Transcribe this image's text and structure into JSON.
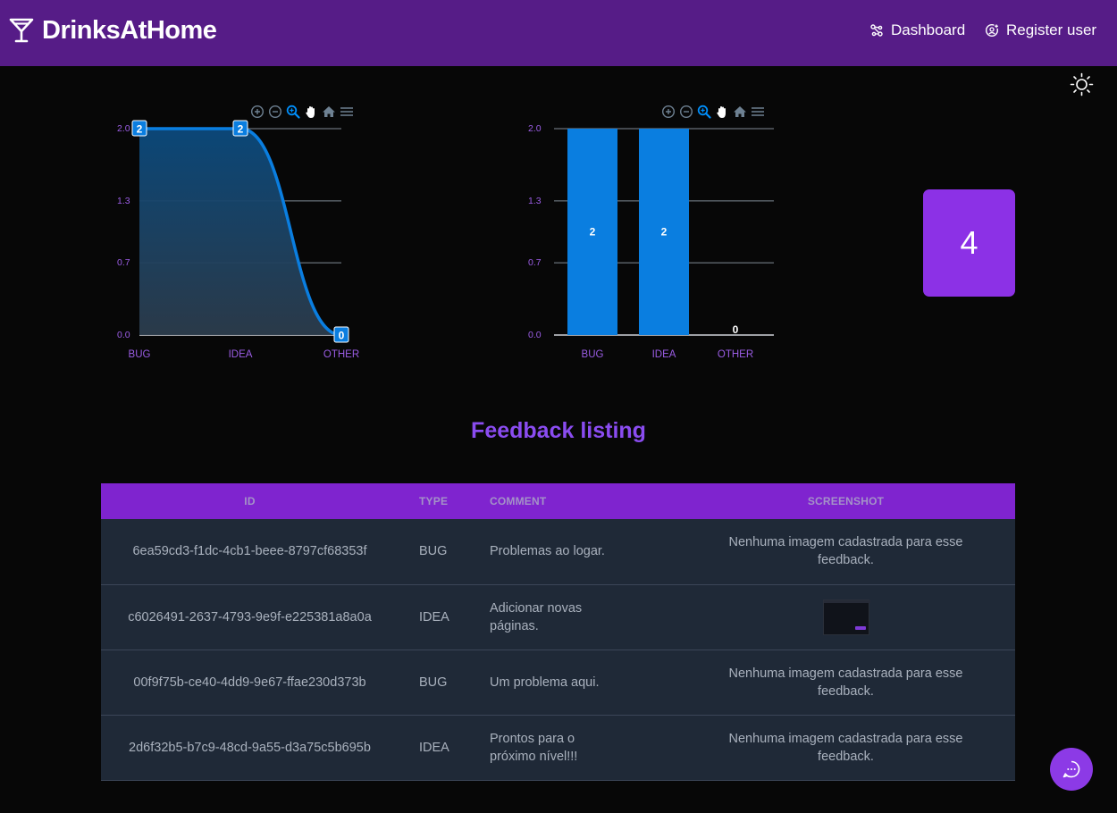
{
  "app": {
    "brand": "DrinksAtHome"
  },
  "nav": {
    "dashboard_label": "Dashboard",
    "register_label": "Register user"
  },
  "charts": {
    "yticks": [
      "0.0",
      "0.7",
      "1.3",
      "2.0"
    ],
    "tick_color": "#9b5de5",
    "series_color": "#0a7ee0"
  },
  "chart_data": [
    {
      "type": "area",
      "categories": [
        "BUG",
        "IDEA",
        "OTHER"
      ],
      "values": [
        2,
        2,
        0
      ],
      "ylim": [
        0,
        2
      ],
      "data_labels": [
        "2",
        "2",
        "0"
      ],
      "grid": true
    },
    {
      "type": "bar",
      "categories": [
        "BUG",
        "IDEA",
        "OTHER"
      ],
      "values": [
        2,
        2,
        0
      ],
      "ylim": [
        0,
        2
      ],
      "data_labels": [
        "2",
        "2",
        "0"
      ],
      "grid": true
    }
  ],
  "total_card": {
    "value": "4",
    "color": "#8c31e6"
  },
  "listing": {
    "title": "Feedback listing",
    "columns": [
      "ID",
      "TYPE",
      "COMMENT",
      "SCREENSHOT"
    ],
    "rows": [
      {
        "id": "6ea59cd3-f1dc-4cb1-beee-8797cf68353f",
        "type": "BUG",
        "comment": "Problemas ao logar.",
        "screenshot": "Nenhuma imagem cadastrada para esse feedback."
      },
      {
        "id": "c6026491-2637-4793-9e9f-e225381a8a0a",
        "type": "IDEA",
        "comment": "Adicionar novas páginas.",
        "screenshot": ""
      },
      {
        "id": "00f9f75b-ce40-4dd9-9e67-ffae230d373b",
        "type": "BUG",
        "comment": "Um problema aqui.",
        "screenshot": "Nenhuma imagem cadastrada para esse feedback."
      },
      {
        "id": "2d6f32b5-b7c9-48cd-9a55-d3a75c5b695b",
        "type": "IDEA",
        "comment": "Prontos para o próximo nível!!!",
        "screenshot": "Nenhuma imagem cadastrada para esse feedback."
      }
    ]
  },
  "icons": {
    "brand": "martini-glass-icon",
    "dashboard": "nodes-icon",
    "register": "user-add-icon",
    "theme": "sun-icon",
    "toolbar": [
      "zoom-in-icon",
      "zoom-out-icon",
      "zoom-select-icon",
      "pan-hand-icon",
      "home-reset-icon",
      "menu-icon"
    ],
    "fab": "chat-bubble-icon"
  },
  "colors": {
    "navbar": "#561c87",
    "accent": "#8c3ae6",
    "table_header": "#7f24cf",
    "row_bg": "#1f2937"
  }
}
